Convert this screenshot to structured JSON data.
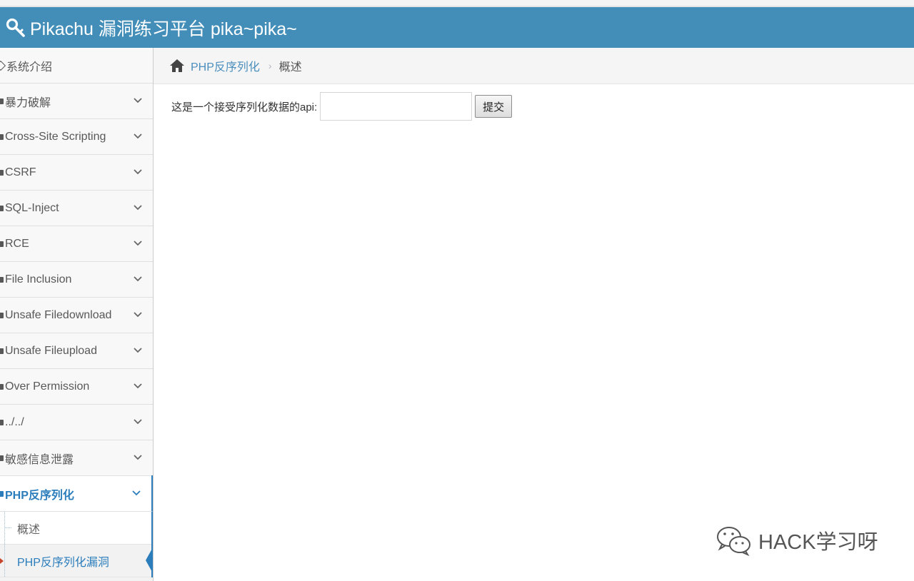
{
  "header": {
    "title": "Pikachu 漏洞练习平台 pika~pika~"
  },
  "sidebar": {
    "items": [
      {
        "label": "系统介绍"
      },
      {
        "label": "暴力破解"
      },
      {
        "label": "Cross-Site Scripting"
      },
      {
        "label": "CSRF"
      },
      {
        "label": "SQL-Inject"
      },
      {
        "label": "RCE"
      },
      {
        "label": "File Inclusion"
      },
      {
        "label": "Unsafe Filedownload"
      },
      {
        "label": "Unsafe Fileupload"
      },
      {
        "label": "Over Permission"
      },
      {
        "label": "../../"
      },
      {
        "label": "敏感信息泄露"
      },
      {
        "label": "PHP反序列化"
      }
    ],
    "submenu": [
      {
        "label": "概述"
      },
      {
        "label": "PHP反序列化漏洞"
      }
    ]
  },
  "breadcrumb": {
    "link": "PHP反序列化",
    "current": "概述"
  },
  "form": {
    "label": "这是一个接受序列化数据的api:",
    "input_value": "",
    "submit_label": "提交"
  },
  "watermark": {
    "text": "HACK学习呀"
  },
  "colors": {
    "navbar": "#438eb9",
    "accent": "#2b7dbc",
    "link": "#4c8fbd"
  }
}
